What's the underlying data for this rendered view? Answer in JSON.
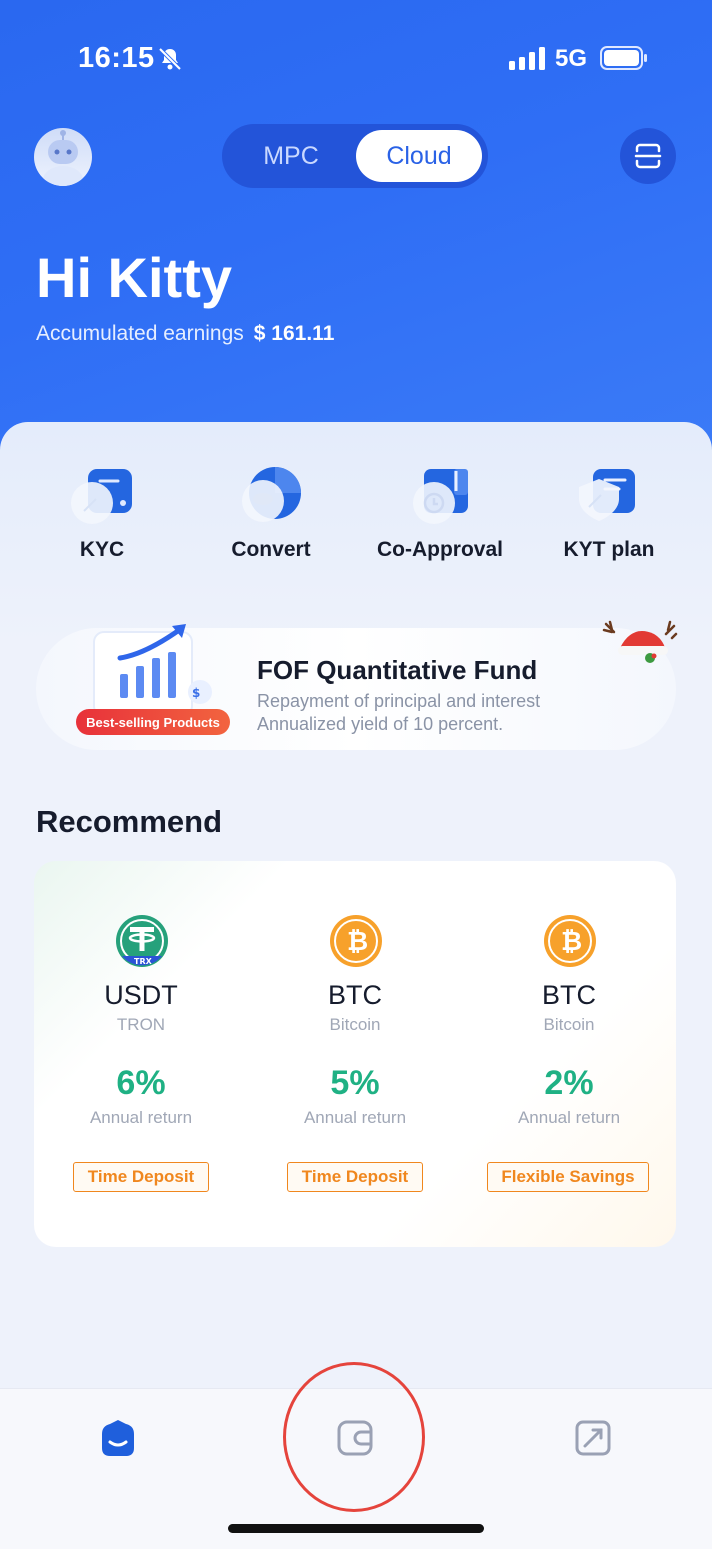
{
  "status": {
    "time": "16:15",
    "network": "5G"
  },
  "header": {
    "segments": [
      {
        "label": "MPC"
      },
      {
        "label": "Cloud"
      }
    ],
    "greeting": "Hi Kitty",
    "earnings_label": "Accumulated earnings",
    "earnings_value": "$ 161.11"
  },
  "quick_actions": [
    {
      "label": "KYC",
      "icon": "kyc-icon"
    },
    {
      "label": "Convert",
      "icon": "convert-icon"
    },
    {
      "label": "Co-Approval",
      "icon": "co-approval-icon"
    },
    {
      "label": "KYT plan",
      "icon": "kyt-plan-icon"
    }
  ],
  "banner": {
    "badge": "Best-selling Products",
    "title": "FOF Quantitative Fund",
    "line1": "Repayment of principal and interest",
    "line2": "Annualized yield of 10 percent."
  },
  "recommend": {
    "title": "Recommend",
    "items": [
      {
        "symbol": "USDT",
        "network": "TRON",
        "coin_badge": "TRX",
        "rate": "6%",
        "rate_label": "Annual return",
        "product": "Time Deposit"
      },
      {
        "symbol": "BTC",
        "network": "Bitcoin",
        "rate": "5%",
        "rate_label": "Annual return",
        "product": "Time Deposit"
      },
      {
        "symbol": "BTC",
        "network": "Bitcoin",
        "rate": "2%",
        "rate_label": "Annual return",
        "product": "Flexible Savings"
      }
    ]
  },
  "tabs": [
    {
      "icon": "home-icon",
      "active": true
    },
    {
      "icon": "wallet-icon",
      "active": false
    },
    {
      "icon": "explore-icon",
      "active": false
    }
  ],
  "colors": {
    "primary": "#2f6ef5",
    "green": "#1fb184",
    "orange": "#f0871e",
    "annotation": "#e5443c"
  }
}
